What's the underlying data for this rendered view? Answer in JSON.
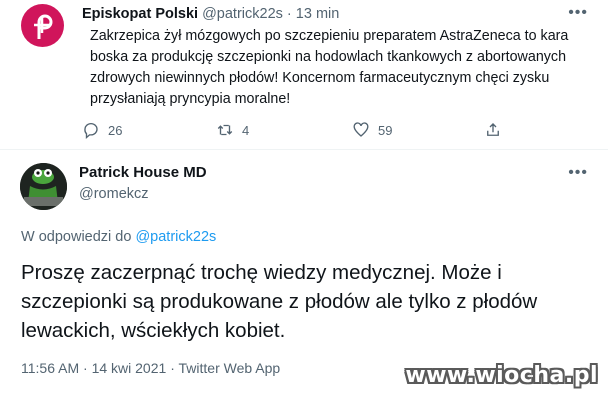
{
  "tweet1": {
    "author_name": "Episkopat Polski",
    "handle": "@patrick22s",
    "separator": "·",
    "time": "13 min",
    "more_icon": "ellipsis-icon",
    "text": "Zakrzepica żył mózgowych po szczepieniu preparatem AstraZeneca to kara boska za produkcję szczepionki na hodowlach tkankowych z abortowanych zdrowych niewinnych płodów! Koncernom farmaceutycznym chęci zysku przysłaniają pryncypia moralne!",
    "replies": "26",
    "retweets": "4",
    "likes": "59",
    "avatar_color": "#d0155b"
  },
  "tweet2": {
    "author_name": "Patrick House MD",
    "handle": "@romekcz",
    "more_icon": "ellipsis-icon",
    "reply_prefix": "W odpowiedzi do",
    "reply_to": "@patrick22s",
    "text": "Proszę zaczerpnąć trochę wiedzy medycznej. Może i szczepionki są produkowane z płodów ale tylko z płodów lewackich, wściekłych kobiet.",
    "time": "11:56 AM",
    "dot": "·",
    "date": "14 kwi 2021",
    "client": "Twitter Web App"
  },
  "watermark": "www.wiocha.pl",
  "colors": {
    "accent": "#1d9bf0",
    "muted": "#536471",
    "text": "#0f1419"
  }
}
